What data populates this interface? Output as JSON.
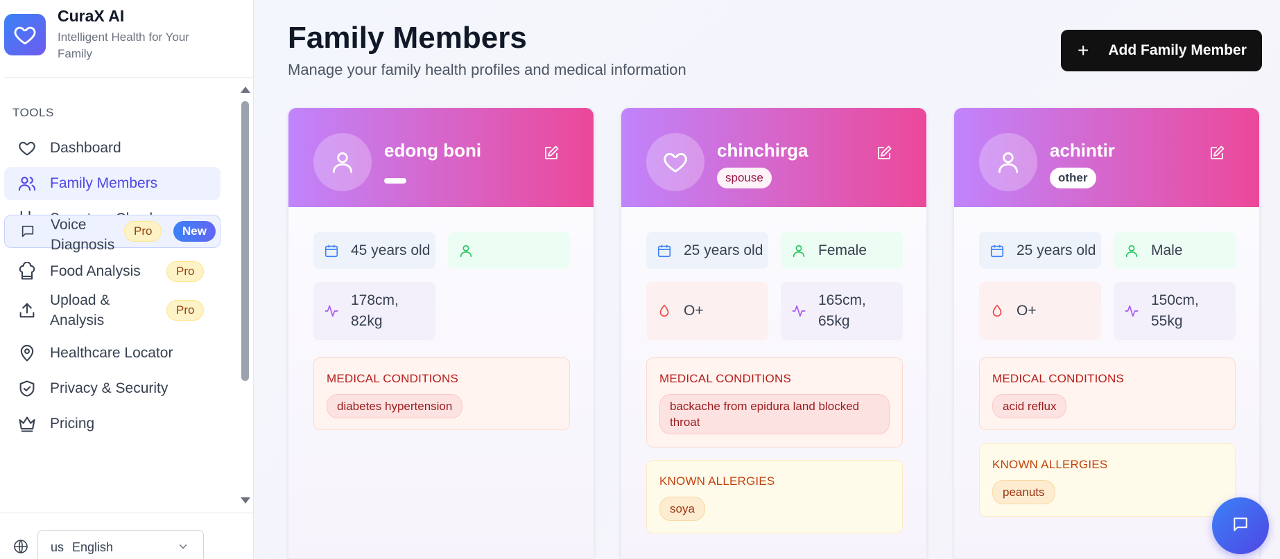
{
  "brand": {
    "name": "CuraX AI",
    "tagline": "Intelligent Health for Your Family"
  },
  "sidebar": {
    "section_label": "TOOLS",
    "items": [
      {
        "label": "Dashboard",
        "icon": "heart-icon"
      },
      {
        "label": "Family Members",
        "icon": "users-icon",
        "active": true
      },
      {
        "label": "Symptom Checker",
        "icon": "stethoscope-icon"
      },
      {
        "label": "Voice Diagnosis",
        "icon": "message-icon",
        "badges": [
          "Pro",
          "New"
        ]
      },
      {
        "label": "Food Analysis",
        "icon": "chef-hat-icon",
        "badges": [
          "Pro"
        ]
      },
      {
        "label": "Upload & Analysis",
        "icon": "upload-icon",
        "badges": [
          "Pro"
        ]
      },
      {
        "label": "Healthcare Locator",
        "icon": "map-pin-icon"
      },
      {
        "label": "Privacy & Security",
        "icon": "shield-icon"
      },
      {
        "label": "Pricing",
        "icon": "crown-icon"
      }
    ],
    "language": {
      "code": "us",
      "label": "English"
    }
  },
  "header": {
    "title": "Family Members",
    "subtitle": "Manage your family health profiles and medical information",
    "add_button": "Add Family Member"
  },
  "members": [
    {
      "name": "edong boni",
      "relationship": "",
      "age": "45 years old",
      "gender": "",
      "height_weight": "178cm, 82kg",
      "conditions_title": "MEDICAL CONDITIONS",
      "conditions": [
        "diabetes hypertension"
      ]
    },
    {
      "name": "chinchirga",
      "relationship": "spouse",
      "age": "25 years old",
      "gender": "Female",
      "blood": "O+",
      "height_weight": "165cm, 65kg",
      "conditions_title": "MEDICAL CONDITIONS",
      "conditions": [
        "backache from epidura land blocked throat"
      ],
      "allergies_title": "KNOWN ALLERGIES",
      "allergies": [
        "soya"
      ]
    },
    {
      "name": "achintir",
      "relationship": "other",
      "age": "25 years old",
      "gender": "Male",
      "blood": "O+",
      "height_weight": "150cm, 55kg",
      "conditions_title": "MEDICAL CONDITIONS",
      "conditions": [
        "acid reflux"
      ],
      "allergies_title": "KNOWN ALLERGIES",
      "allergies": [
        "peanuts"
      ]
    }
  ],
  "colors": {
    "accent": "#4f46e5",
    "header_gradient_start": "#c084fc",
    "header_gradient_end": "#ec4899",
    "primary_button": "#111111"
  }
}
